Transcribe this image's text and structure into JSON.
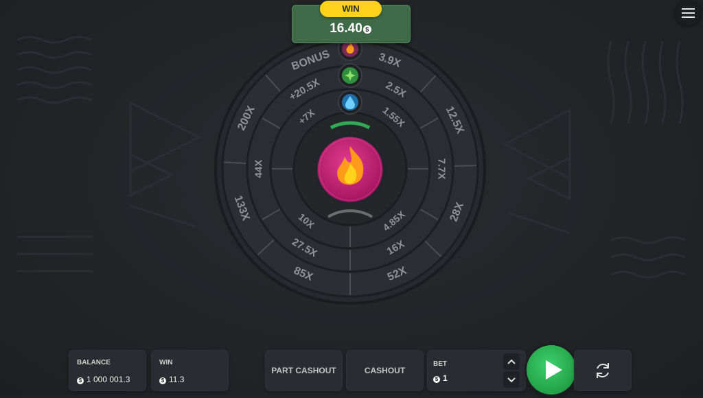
{
  "win_display": {
    "label": "WIN",
    "amount": "16.40",
    "coin": "$"
  },
  "menu": {
    "icon": "hamburger-menu-icon"
  },
  "wheel": {
    "center_icon": "fire-icon",
    "pointer_icons": [
      "fire-icon",
      "leaf-icon",
      "water-drop-icon"
    ],
    "outer_ring": [
      "BONUS",
      "3.9X",
      "12.5X",
      "28X",
      "52X",
      "85X",
      "133X",
      "200X"
    ],
    "middle_ring": [
      "+20.5X",
      "2.5X",
      "7.7X",
      "16X",
      "27.5X",
      "44X"
    ],
    "inner_ring": [
      "+7X",
      "1.55X",
      "4.85X",
      "10X"
    ],
    "colors": {
      "center": "#c51d78",
      "fire": "#ff9a1a",
      "accent_green": "#3fd06c"
    }
  },
  "bottom_bar": {
    "balance": {
      "label": "BALANCE",
      "value": "1 000 001.3",
      "coin": "$"
    },
    "win": {
      "label": "WIN",
      "value": "11.3",
      "coin": "$"
    },
    "part_cashout_label": "PART CASHOUT",
    "cashout_label": "CASHOUT",
    "bet": {
      "label": "BET",
      "value": "1",
      "coin": "$"
    },
    "play_icon": "play-icon",
    "autoplay_icon": "refresh-icon"
  }
}
